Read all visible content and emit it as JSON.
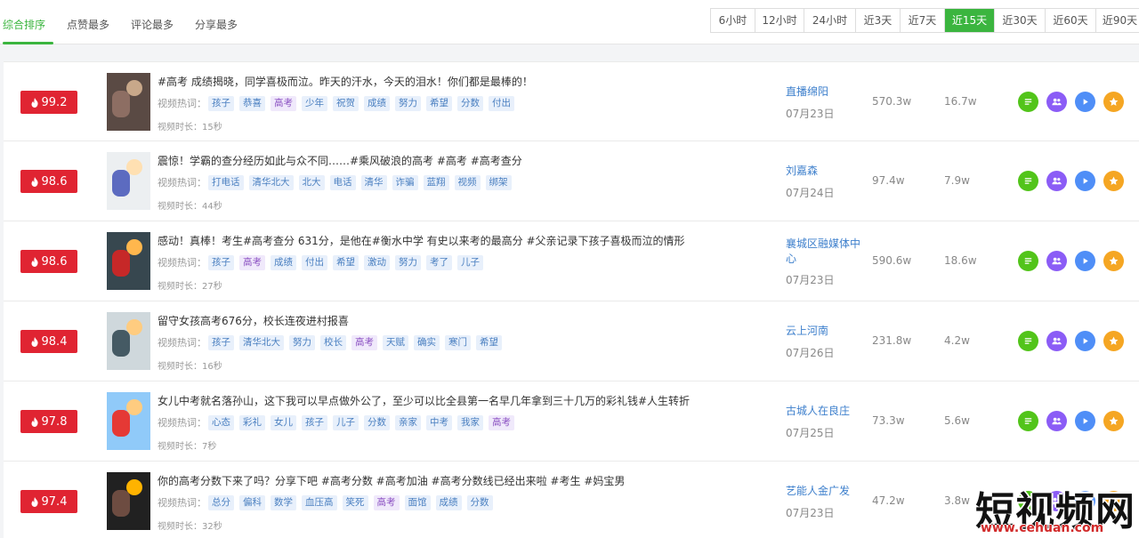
{
  "sort_tabs": [
    {
      "label": "综合排序",
      "active": true
    },
    {
      "label": "点赞最多",
      "active": false
    },
    {
      "label": "评论最多",
      "active": false
    },
    {
      "label": "分享最多",
      "active": false
    }
  ],
  "time_tabs": [
    {
      "label": "6小时",
      "active": false
    },
    {
      "label": "12小时",
      "active": false
    },
    {
      "label": "24小时",
      "active": false
    },
    {
      "label": "近3天",
      "active": false
    },
    {
      "label": "近7天",
      "active": false
    },
    {
      "label": "近15天",
      "active": true
    },
    {
      "label": "近30天",
      "active": false
    },
    {
      "label": "近60天",
      "active": false
    },
    {
      "label": "近90天",
      "active": false
    }
  ],
  "labels": {
    "tags_label": "视频热词：",
    "duration_prefix": "视频时长："
  },
  "colors": {
    "accent": "#3bb53f",
    "score_badge": "#e02432",
    "link": "#3d7fcc",
    "action_green": "#52c41a",
    "action_purple": "#8b5cf6",
    "action_blue": "#4f8ef7",
    "action_orange": "#f5a623"
  },
  "action_icons": [
    "list-icon",
    "users-icon",
    "play-icon",
    "star-icon"
  ],
  "rows": [
    {
      "score": "99.2",
      "title": "#高考 成绩揭晓，同学喜极而泣。昨天的汗水，今天的泪水！你们都是最棒的！",
      "tags": [
        "孩子",
        "恭喜",
        "高考",
        "少年",
        "祝贺",
        "成绩",
        "努力",
        "希望",
        "分数",
        "付出"
      ],
      "alt_tags": [
        2
      ],
      "duration": "15秒",
      "author": "直播绵阳",
      "date": "07月23日",
      "plays": "570.3w",
      "likes": "16.7w"
    },
    {
      "score": "98.6",
      "title": "震惊！学霸的查分经历如此与众不同……#乘风破浪的高考 #高考 #高考查分",
      "tags": [
        "打电话",
        "清华北大",
        "北大",
        "电话",
        "清华",
        "诈骗",
        "蓝翔",
        "视频",
        "绑架"
      ],
      "alt_tags": [],
      "duration": "44秒",
      "author": "刘嘉森",
      "date": "07月24日",
      "plays": "97.4w",
      "likes": "7.9w"
    },
    {
      "score": "98.6",
      "title": "感动！真棒！考生#高考查分 631分，是他在#衡水中学 有史以来考的最高分 #父亲记录下孩子喜极而泣的情形",
      "tags": [
        "孩子",
        "高考",
        "成绩",
        "付出",
        "希望",
        "激动",
        "努力",
        "考了",
        "儿子"
      ],
      "alt_tags": [
        1
      ],
      "duration": "27秒",
      "author": "襄城区融媒体中心",
      "date": "07月23日",
      "plays": "590.6w",
      "likes": "18.6w"
    },
    {
      "score": "98.4",
      "title": "留守女孩高考676分，校长连夜进村报喜",
      "tags": [
        "孩子",
        "清华北大",
        "努力",
        "校长",
        "高考",
        "天赋",
        "确实",
        "寒门",
        "希望"
      ],
      "alt_tags": [
        4
      ],
      "duration": "16秒",
      "author": "云上河南",
      "date": "07月26日",
      "plays": "231.8w",
      "likes": "4.2w"
    },
    {
      "score": "97.8",
      "title": "女儿中考就名落孙山，这下我可以早点做外公了，至少可以比全县第一名早几年拿到三十几万的彩礼钱#人生转折",
      "tags": [
        "心态",
        "彩礼",
        "女儿",
        "孩子",
        "儿子",
        "分数",
        "亲家",
        "中考",
        "我家",
        "高考"
      ],
      "alt_tags": [
        9
      ],
      "duration": "7秒",
      "author": "古城人在良庄",
      "date": "07月25日",
      "plays": "73.3w",
      "likes": "5.6w"
    },
    {
      "score": "97.4",
      "title": "你的高考分数下来了吗？分享下吧 #高考分数 #高考加油 #高考分数线已经出来啦 #考生 #妈宝男",
      "tags": [
        "总分",
        "偏科",
        "数学",
        "血压高",
        "笑死",
        "高考",
        "面馆",
        "成绩",
        "分数"
      ],
      "alt_tags": [
        5
      ],
      "duration": "32秒",
      "author": "艺能人金广发",
      "date": "07月23日",
      "plays": "47.2w",
      "likes": "3.8w"
    }
  ],
  "watermark": {
    "main": "短视频网",
    "sub": "www.cehuan.com"
  }
}
